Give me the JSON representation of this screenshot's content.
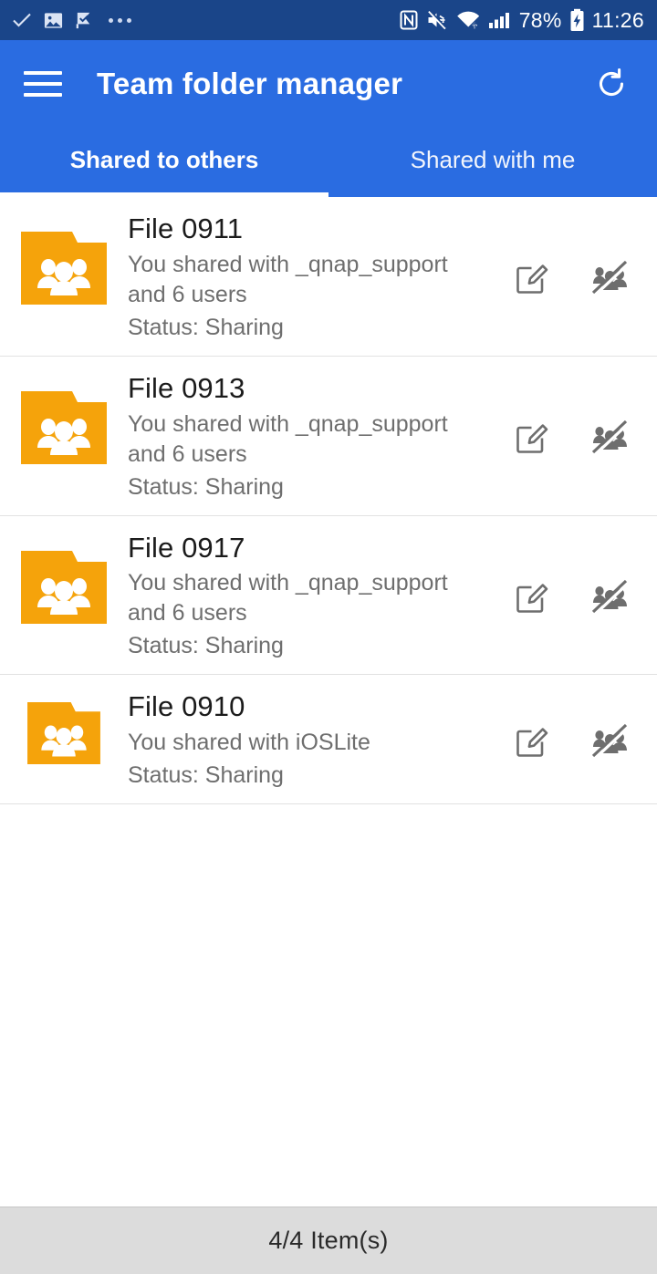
{
  "statusbar": {
    "left_icons": [
      "check-icon",
      "image-icon",
      "flag-icon",
      "overflow-dots-icon"
    ],
    "nfc_icon": "nfc-icon",
    "mute_icon": "volume-mute-icon",
    "wifi_icon": "wifi-icon",
    "signal_icon": "cellular-signal-icon",
    "battery_percent": "78%",
    "battery_icon": "battery-charging-icon",
    "clock": "11:26"
  },
  "appbar": {
    "menu_icon": "hamburger-menu-icon",
    "title": "Team folder manager",
    "refresh_icon": "refresh-icon",
    "background": "#2a6ce1"
  },
  "tabs": {
    "items": [
      {
        "label": "Shared to others",
        "active": true
      },
      {
        "label": "Shared with me",
        "active": false
      }
    ],
    "indicator_color": "#ffffff"
  },
  "list": {
    "folder_icon_color": "#f5a30b",
    "edit_icon": "edit-pencil-square-icon",
    "unshare_icon": "stop-sharing-people-slash-icon",
    "rows": [
      {
        "name": "File 0911",
        "shared_with": "You shared with _qnap_support and 6 users",
        "status": "Status: Sharing",
        "folder_icon": "shared-folder-icon"
      },
      {
        "name": "File 0913",
        "shared_with": "You shared with _qnap_support and 6 users",
        "status": "Status: Sharing",
        "folder_icon": "shared-folder-icon"
      },
      {
        "name": "File 0917",
        "shared_with": "You shared with _qnap_support and 6 users",
        "status": "Status: Sharing",
        "folder_icon": "shared-folder-icon"
      },
      {
        "name": "File 0910",
        "shared_with": "You shared with iOSLite",
        "status": "Status: Sharing",
        "folder_icon": "shared-folder-icon"
      }
    ]
  },
  "footer": {
    "count_text": "4/4 Item(s)"
  }
}
